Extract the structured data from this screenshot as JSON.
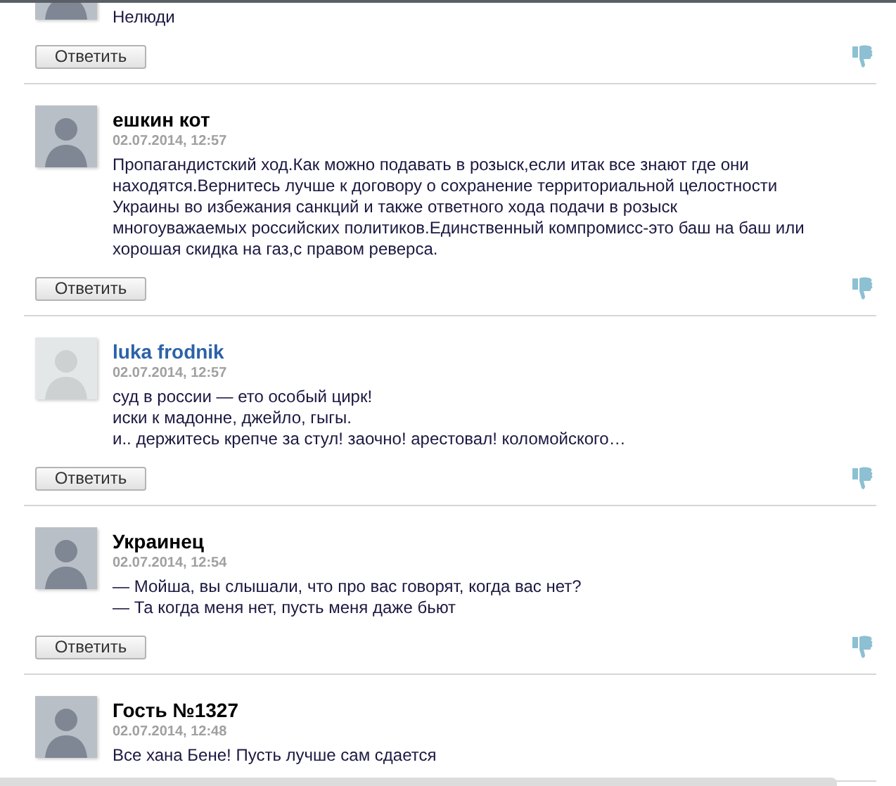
{
  "comments": [
    {
      "registered": false,
      "text": "Нелюди",
      "reply": "Ответить"
    },
    {
      "author": "ешкин кот",
      "registered": false,
      "date": "02.07.2014, 12:57",
      "text": "Пропагандистский ход.Как можно подавать в розыск,если итак все знают где они находятся.Вернитесь лучше к договору о сохранение территориальной целостности Украины во избежания санкций и также ответного хода подачи в розыск многоуважаемых российских политиков.Единственный компромисс-это баш на баш или хорошая скидка на газ,с правом реверса.",
      "reply": "Ответить"
    },
    {
      "author": "luka frodnik",
      "registered": true,
      "date": "02.07.2014, 12:57",
      "text": "суд в россии — ето особый цирк!\nиски к мадонне, джейло, гыгы.\nи.. держитесь крепче за стул! заочно! арестовал! коломойского…",
      "reply": "Ответить"
    },
    {
      "author": "Украинец",
      "registered": false,
      "date": "02.07.2014, 12:54",
      "text": "— Мойша, вы слышали, что про вас говорят, когда вас нет?\n— Та когда меня нет, пусть меня даже бьют",
      "reply": "Ответить"
    },
    {
      "author": "Гость №1327",
      "registered": false,
      "date": "02.07.2014, 12:48",
      "text": "Все хана Бене! Пусть лучше сам сдается"
    }
  ]
}
